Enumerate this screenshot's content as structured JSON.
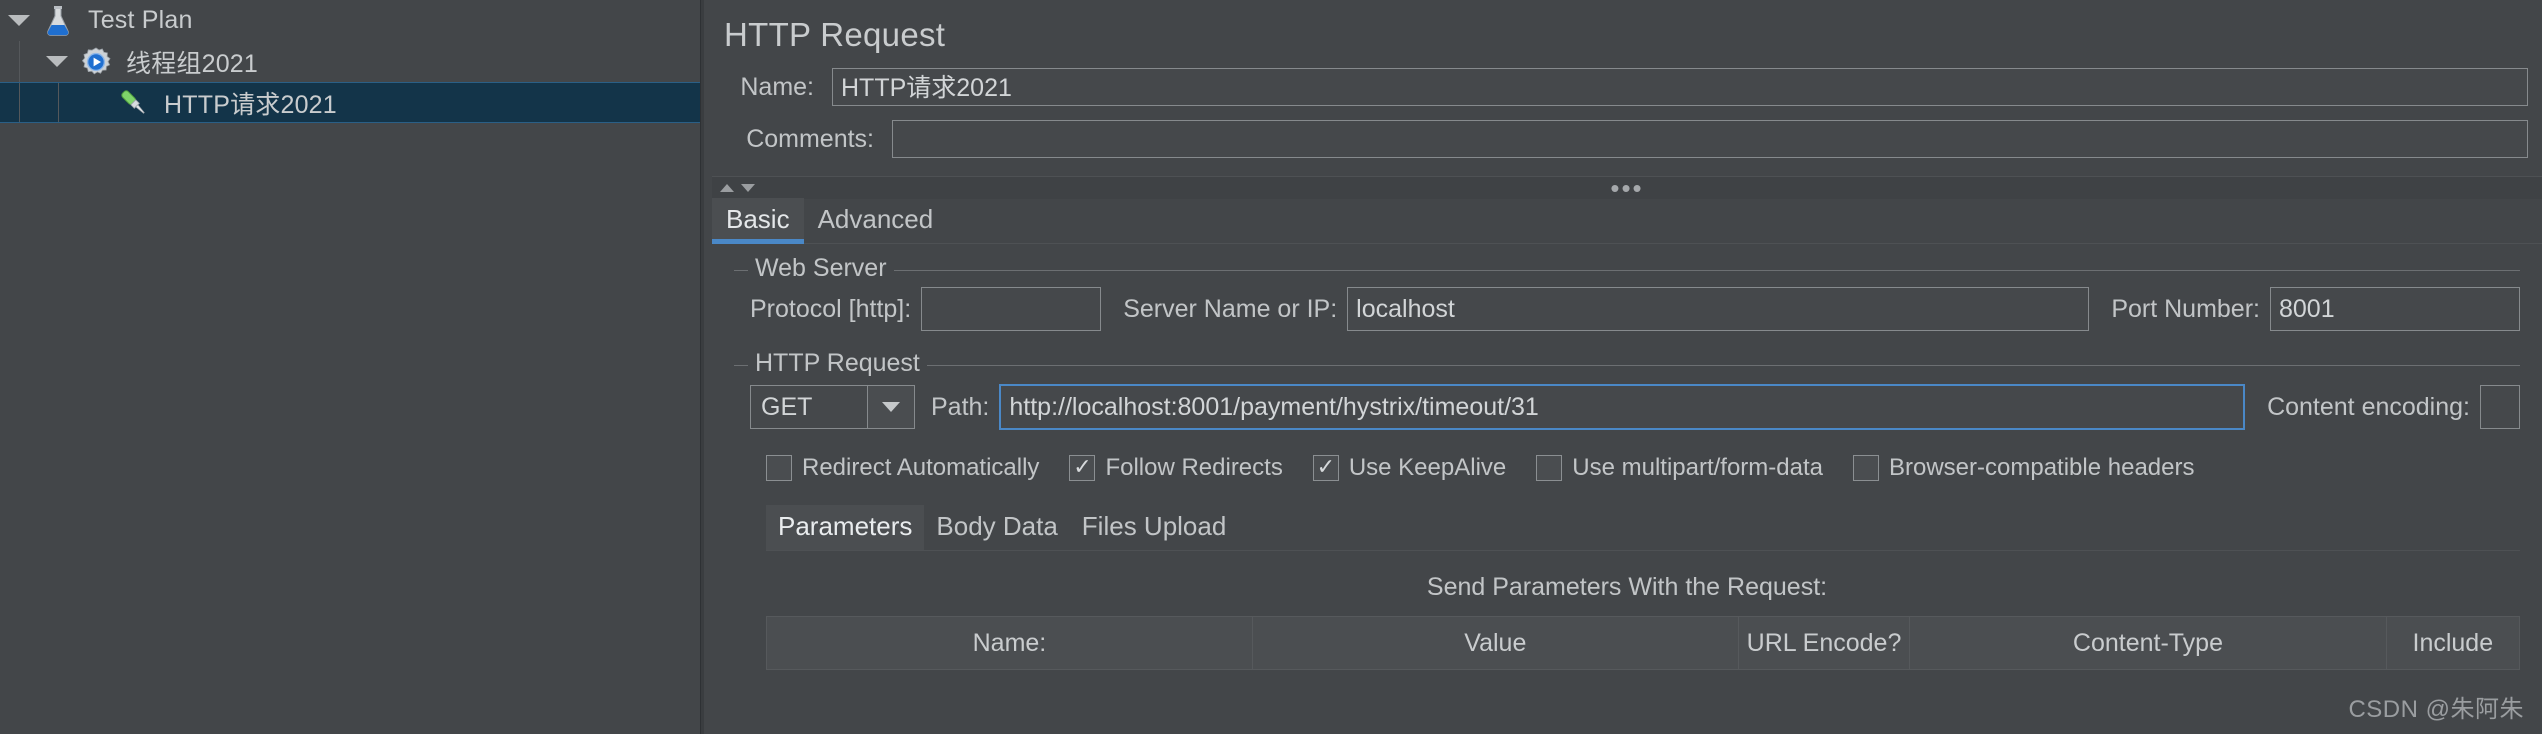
{
  "tree": {
    "nodes": [
      {
        "label": "Test Plan",
        "icon": "flask-icon",
        "depth": 0,
        "expanded": true,
        "selected": false
      },
      {
        "label": "线程组2021",
        "icon": "thread-group-icon",
        "depth": 1,
        "expanded": true,
        "selected": false
      },
      {
        "label": "HTTP请求2021",
        "icon": "http-sampler-icon",
        "depth": 2,
        "expanded": false,
        "selected": true
      }
    ]
  },
  "panel": {
    "title": "HTTP Request",
    "name_label": "Name:",
    "name_value": "HTTP请求2021",
    "comments_label": "Comments:",
    "comments_value": "",
    "tabs": [
      {
        "label": "Basic",
        "active": true
      },
      {
        "label": "Advanced",
        "active": false
      }
    ],
    "web_server": {
      "title": "Web Server",
      "protocol_label": "Protocol [http]:",
      "protocol_value": "",
      "server_label": "Server Name or IP:",
      "server_value": "localhost",
      "port_label": "Port Number:",
      "port_value": "8001"
    },
    "http_request": {
      "title": "HTTP Request",
      "method_value": "GET",
      "path_label": "Path:",
      "path_value": "http://localhost:8001/payment/hystrix/timeout/31",
      "content_encoding_label": "Content encoding:",
      "content_encoding_value": "",
      "checkboxes": [
        {
          "label": "Redirect Automatically",
          "checked": false
        },
        {
          "label": "Follow Redirects",
          "checked": true
        },
        {
          "label": "Use KeepAlive",
          "checked": true
        },
        {
          "label": "Use multipart/form-data",
          "checked": false
        },
        {
          "label": "Browser-compatible headers",
          "checked": false
        }
      ],
      "subtabs": [
        {
          "label": "Parameters",
          "active": true
        },
        {
          "label": "Body Data",
          "active": false
        },
        {
          "label": "Files Upload",
          "active": false
        }
      ],
      "send_params_title": "Send Parameters With the Request:",
      "table_headers": [
        "Name:",
        "Value",
        "URL Encode?",
        "Content-Type",
        "Include"
      ]
    }
  },
  "watermark": "CSDN @朱阿朱",
  "colors": {
    "accent": "#4a88c7",
    "panel_bg": "#434649",
    "selection_bg": "#133449",
    "text": "#c9ccce"
  }
}
